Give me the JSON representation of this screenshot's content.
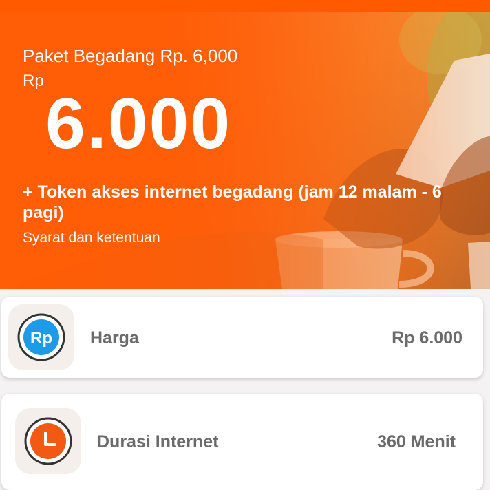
{
  "banner": {
    "plan_title": "Paket Begadang Rp. 6,000",
    "currency": "Rp",
    "price": "6.000",
    "token_description": "+ Token akses internet begadang (jam 12 malam - 6 pagi)",
    "terms_label": "Syarat dan ketentuan"
  },
  "details": [
    {
      "label": "Harga",
      "value": "Rp 6.000",
      "icon": "rupiah-icon",
      "icon_text": "Rp",
      "icon_color": "#1e9be8"
    },
    {
      "label": "Durasi Internet",
      "value": "360 Menit",
      "icon": "clock-icon",
      "icon_color": "#f25a13"
    }
  ],
  "colors": {
    "accent": "#ff5a00",
    "text_muted": "#6b6b6b"
  }
}
